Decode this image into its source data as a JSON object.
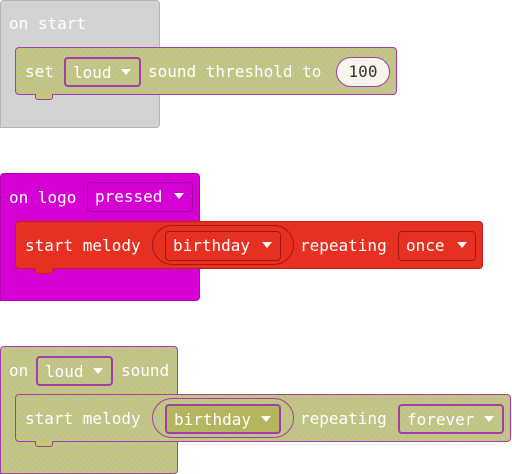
{
  "block1": {
    "hat_label": "on start",
    "set_label": "set",
    "dropdown_value": "loud",
    "middle_text": "sound threshold to",
    "number_value": "100"
  },
  "block2": {
    "hat_label": "on logo",
    "hat_dropdown": "pressed",
    "start_label": "start melody",
    "melody_value": "birthday",
    "repeating_label": "repeating",
    "repeat_value": "once"
  },
  "block3": {
    "hat_label": "on",
    "hat_dropdown": "loud",
    "hat_suffix": "sound",
    "start_label": "start melody",
    "melody_value": "birthday",
    "repeating_label": "repeating",
    "repeat_value": "forever"
  },
  "colors": {
    "on_start_gray": "#d3d3d3",
    "logo_magenta": "#d400d4",
    "music_red": "#e63022",
    "disabled_mesh": "#c8c86e",
    "disabled_outline": "#a33ea8"
  },
  "icons": {
    "dropdown": "caret-down-icon"
  }
}
